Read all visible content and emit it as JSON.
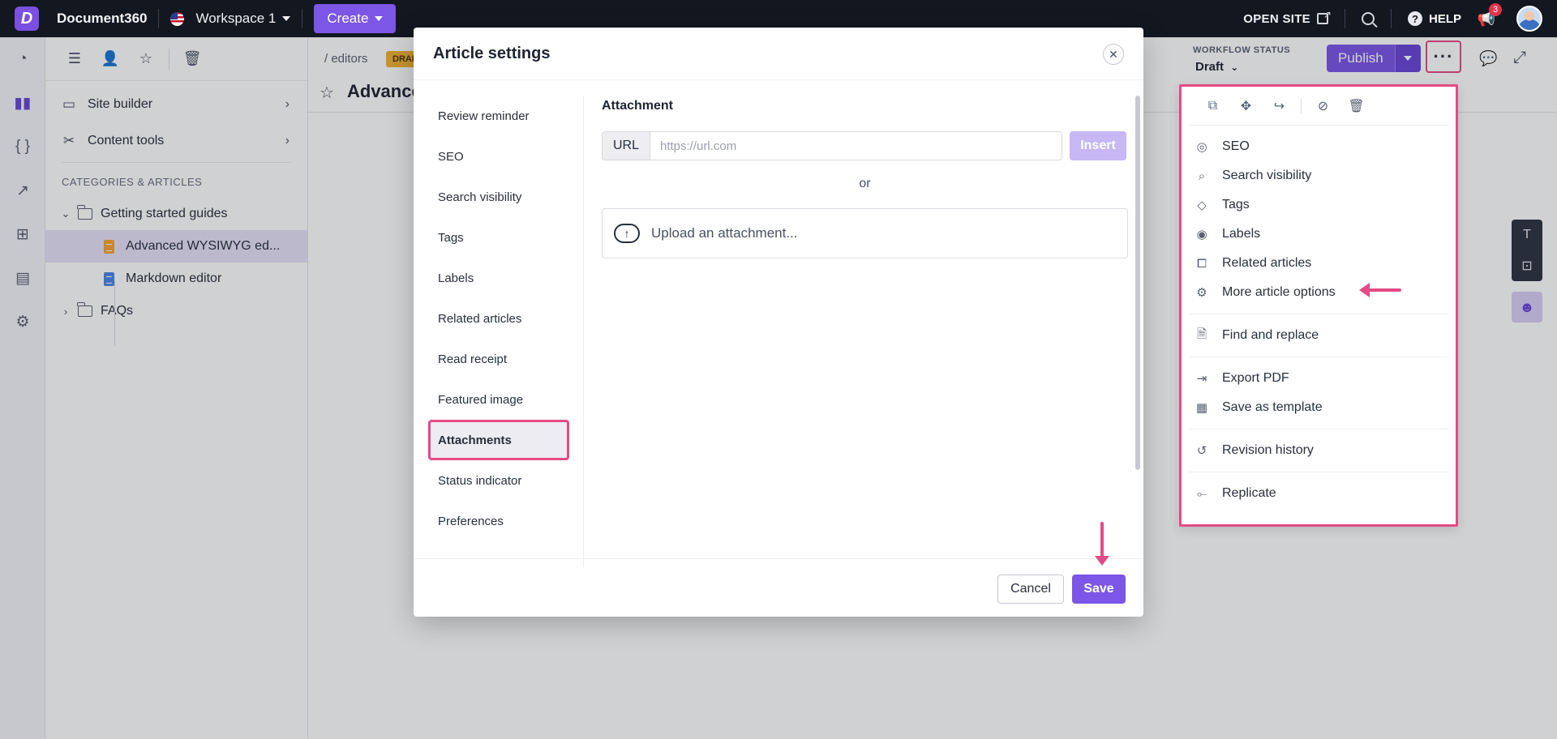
{
  "topbar": {
    "brand": "Document360",
    "workspace": "Workspace 1",
    "create_label": "Create",
    "open_site_label": "OPEN SITE",
    "help_label": "HELP",
    "notification_count": "3"
  },
  "rail": {
    "icons": [
      "dashboard-icon",
      "documentation-icon",
      "api-icon",
      "analytics-icon",
      "apps-icon",
      "drive-icon",
      "settings-icon"
    ]
  },
  "catpanel": {
    "nav_items": [
      {
        "label": "Site builder"
      },
      {
        "label": "Content tools"
      }
    ],
    "section_heading": "CATEGORIES & ARTICLES",
    "tree": {
      "folder_1": "Getting started guides",
      "article_1": "Advanced WYSIWYG ed...",
      "article_2": "Markdown editor",
      "folder_2": "FAQs"
    }
  },
  "editor": {
    "breadcrumb": "/ editors",
    "status_pill": "DRAFT",
    "article_title": "Advanced",
    "workflow_label": "WORKFLOW STATUS",
    "workflow_value": "Draft",
    "publish_label": "Publish",
    "more_label": "···"
  },
  "modal": {
    "title": "Article settings",
    "tabs": [
      {
        "label": "Review reminder"
      },
      {
        "label": "SEO"
      },
      {
        "label": "Search visibility"
      },
      {
        "label": "Tags"
      },
      {
        "label": "Labels"
      },
      {
        "label": "Related articles"
      },
      {
        "label": "Read receipt"
      },
      {
        "label": "Featured image"
      },
      {
        "label": "Attachments"
      },
      {
        "label": "Status indicator"
      },
      {
        "label": "Preferences"
      }
    ],
    "active_tab": "Attachments",
    "section_title": "Attachment",
    "url_label": "URL",
    "url_placeholder": "https://url.com",
    "insert_label": "Insert",
    "or_text": "or",
    "upload_text": "Upload an attachment...",
    "cancel_label": "Cancel",
    "save_label": "Save"
  },
  "dropdown": {
    "groups": [
      [
        {
          "label": "SEO",
          "icon": "globe-icon"
        },
        {
          "label": "Search visibility",
          "icon": "search-visibility-icon"
        },
        {
          "label": "Tags",
          "icon": "tag-icon"
        },
        {
          "label": "Labels",
          "icon": "label-icon"
        },
        {
          "label": "Related articles",
          "icon": "related-articles-icon"
        },
        {
          "label": "More article options",
          "icon": "gear-icon"
        }
      ],
      [
        {
          "label": "Find and replace",
          "icon": "find-replace-icon"
        }
      ],
      [
        {
          "label": "Export PDF",
          "icon": "export-pdf-icon"
        },
        {
          "label": "Save as template",
          "icon": "template-icon"
        }
      ],
      [
        {
          "label": "Revision history",
          "icon": "history-icon"
        }
      ],
      [
        {
          "label": "Replicate",
          "icon": "replicate-icon"
        }
      ]
    ]
  },
  "colors": {
    "accent": "#7c56e6",
    "highlight": "#e44b86",
    "topbar": "#121720"
  }
}
